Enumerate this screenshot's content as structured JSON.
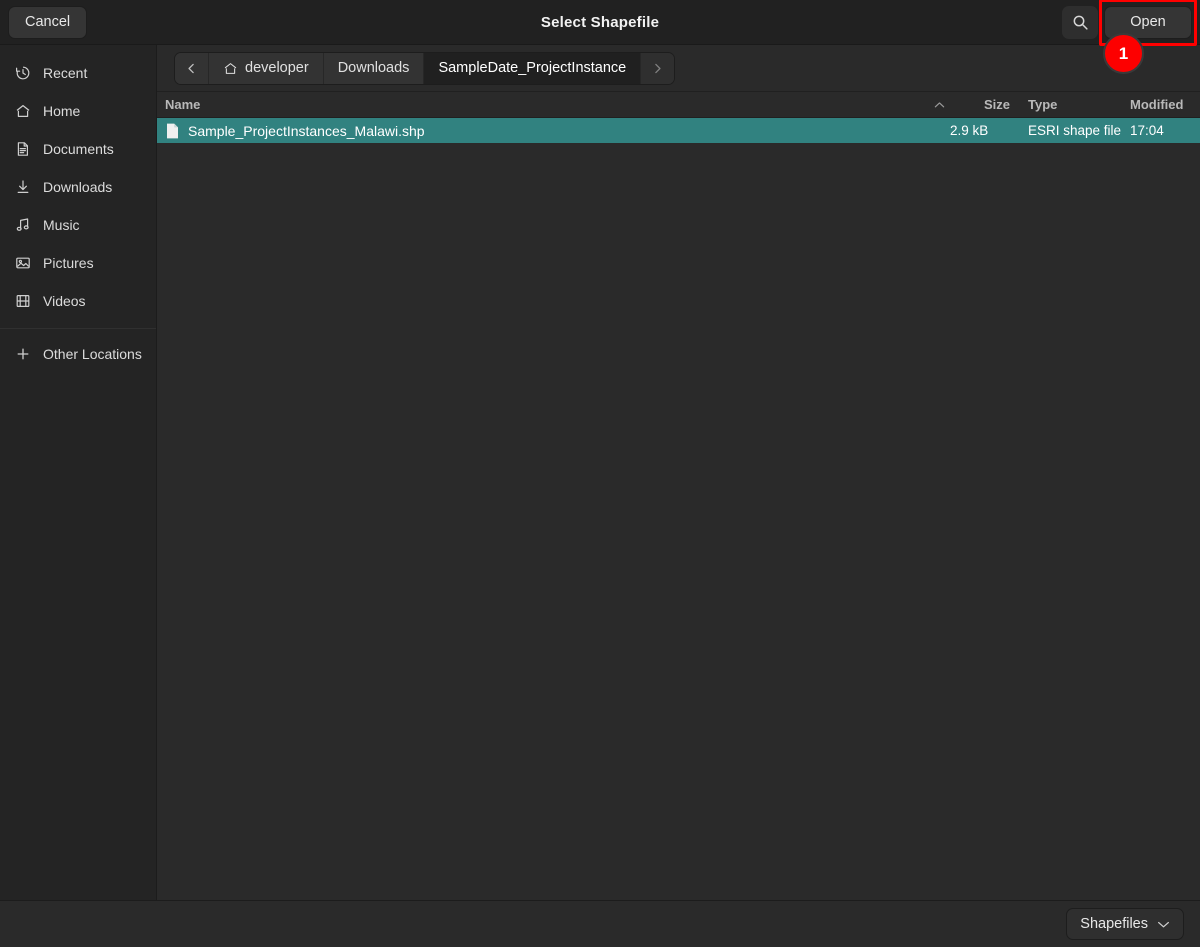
{
  "window": {
    "title": "Select Shapefile",
    "cancel_label": "Cancel",
    "open_label": "Open",
    "search_icon": "search-icon",
    "badge_number": "1",
    "highlight_color": "#ff0000",
    "badge_color": "#fd0000"
  },
  "sidebar": {
    "items": [
      {
        "label": "Recent",
        "icon": "clock-icon"
      },
      {
        "label": "Home",
        "icon": "home-icon"
      },
      {
        "label": "Documents",
        "icon": "document-icon"
      },
      {
        "label": "Downloads",
        "icon": "download-icon"
      },
      {
        "label": "Music",
        "icon": "music-note-icon"
      },
      {
        "label": "Pictures",
        "icon": "picture-icon"
      },
      {
        "label": "Videos",
        "icon": "film-icon"
      }
    ],
    "other_locations": {
      "label": "Other Locations",
      "icon": "plus-icon"
    }
  },
  "pathbar": {
    "back_icon": "chevron-left-icon",
    "forward_icon": "chevron-right-icon",
    "crumbs": [
      {
        "label": "developer",
        "icon": "home-icon",
        "active": false
      },
      {
        "label": "Downloads",
        "icon": "",
        "active": false
      },
      {
        "label": "SampleDate_ProjectInstance",
        "icon": "",
        "active": true
      }
    ]
  },
  "filelist": {
    "columns": {
      "name": "Name",
      "sort_indicator": "⌃",
      "size": "Size",
      "type": "Type",
      "modified": "Modified"
    },
    "rows": [
      {
        "name": "Sample_ProjectInstances_Malawi.shp",
        "size": "2.9 kB",
        "type": "ESRI shape file",
        "modified": "17:04",
        "icon": "file-icon",
        "selected": true
      }
    ],
    "selection_color": "#318280"
  },
  "footer": {
    "filter_label": "Shapefiles",
    "filter_chevron": "chevron-down-icon"
  }
}
